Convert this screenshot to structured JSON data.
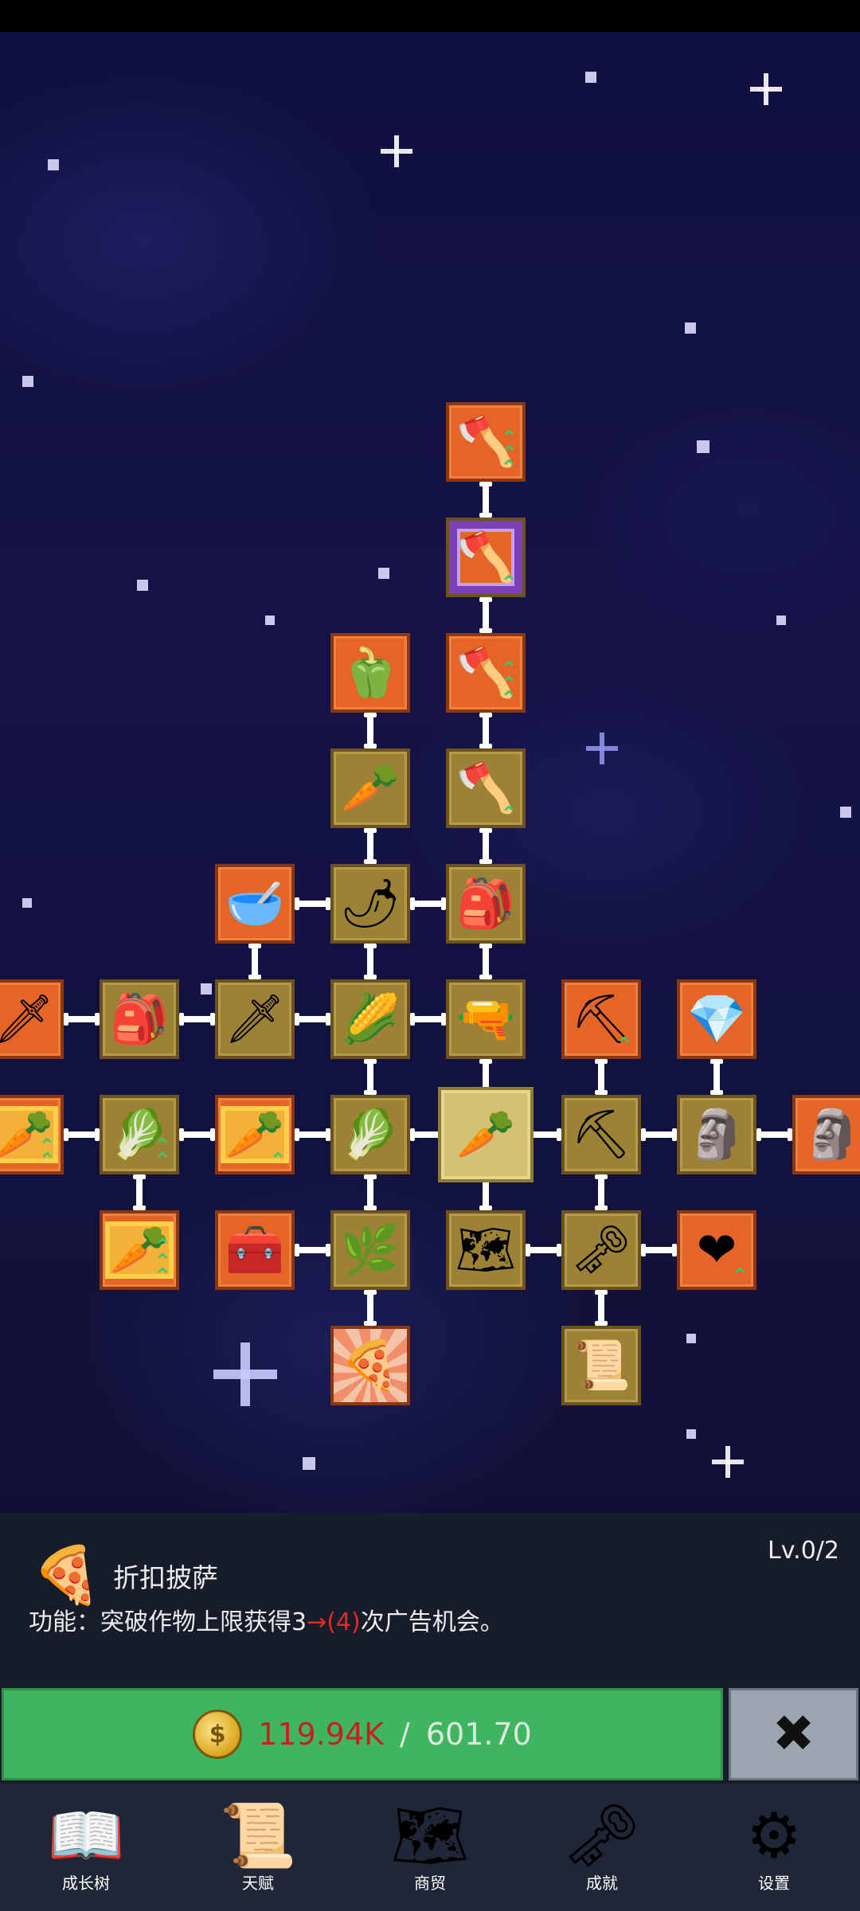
{
  "skill_tree": {
    "nodes": [
      {
        "id": "shovel-top",
        "icon": "🪓",
        "icon_name": "shovel-icon",
        "style": "orange",
        "badge": "⌃⌃⌃"
      },
      {
        "id": "shovel-magic",
        "icon": "🪓",
        "icon_name": "magic-shovel-icon",
        "style": "purple",
        "badge": "⌃"
      },
      {
        "id": "pepper",
        "icon": "🫑",
        "icon_name": "bell-pepper-icon",
        "style": "orange",
        "badge": ""
      },
      {
        "id": "shovel-3",
        "icon": "🪓",
        "icon_name": "shovel-icon",
        "style": "orange",
        "badge": "⌃⌃⌃"
      },
      {
        "id": "radish",
        "icon": "🥕",
        "icon_name": "white-radish-icon",
        "style": "gold",
        "badge": ""
      },
      {
        "id": "shovel-4",
        "icon": "🪓",
        "icon_name": "shovel-icon",
        "style": "gold",
        "badge": "⌃"
      },
      {
        "id": "bowl",
        "icon": "🥣",
        "icon_name": "wooden-bowl-icon",
        "style": "orange",
        "badge": ""
      },
      {
        "id": "chili",
        "icon": "🌶",
        "icon_name": "chili-pepper-icon",
        "style": "gold",
        "badge": ""
      },
      {
        "id": "backpack-1",
        "icon": "🎒",
        "icon_name": "backpack-icon",
        "style": "gold",
        "badge": ""
      },
      {
        "id": "sword-edge",
        "icon": "🗡",
        "icon_name": "sword-icon",
        "style": "orange",
        "badge": ""
      },
      {
        "id": "backpack-2",
        "icon": "🎒",
        "icon_name": "backpack-icon",
        "style": "gold",
        "badge": ""
      },
      {
        "id": "sword-2",
        "icon": "🗡",
        "icon_name": "sword-icon",
        "style": "gold",
        "badge": ""
      },
      {
        "id": "corn",
        "icon": "🌽",
        "icon_name": "corn-icon",
        "style": "gold",
        "badge": ""
      },
      {
        "id": "rifle",
        "icon": "🔫",
        "icon_name": "rifle-icon",
        "style": "gold",
        "badge": ""
      },
      {
        "id": "pickaxe-orange",
        "icon": "⛏",
        "icon_name": "pickaxe-icon",
        "style": "orange",
        "badge": "⌃"
      },
      {
        "id": "crystal",
        "icon": "💎",
        "icon_name": "crystal-icon",
        "style": "orange",
        "badge": ""
      },
      {
        "id": "carrot-edge",
        "icon": "🥕",
        "icon_name": "carrot-icon",
        "style": "orange-yellow",
        "badge": "⌃⌃"
      },
      {
        "id": "cabbage-1",
        "icon": "🥬",
        "icon_name": "cabbage-icon",
        "style": "gold",
        "badge": "⌃⌃"
      },
      {
        "id": "carrot-2",
        "icon": "🥕",
        "icon_name": "carrot-icon",
        "style": "orange-yellow",
        "badge": "⌃"
      },
      {
        "id": "cabbage-2",
        "icon": "🥬",
        "icon_name": "cabbage-icon",
        "style": "gold",
        "badge": ""
      },
      {
        "id": "carrot-root",
        "icon": "🥕",
        "icon_name": "carrot-icon",
        "style": "selected",
        "badge": ""
      },
      {
        "id": "pickaxe-gold",
        "icon": "⛏",
        "icon_name": "pickaxe-icon",
        "style": "gold",
        "badge": ""
      },
      {
        "id": "statue-1",
        "icon": "🗿",
        "icon_name": "statue-icon",
        "style": "gold",
        "badge": ""
      },
      {
        "id": "statue-edge",
        "icon": "🗿",
        "icon_name": "statue-icon",
        "style": "orange",
        "badge": ""
      },
      {
        "id": "carrot-3",
        "icon": "🥕",
        "icon_name": "carrot-icon",
        "style": "orange-yellow",
        "badge": "⌃⌃⌃"
      },
      {
        "id": "chest",
        "icon": "🧰",
        "icon_name": "treasure-chest-icon",
        "style": "orange",
        "badge": ""
      },
      {
        "id": "leek",
        "icon": "🌿",
        "icon_name": "leek-icon",
        "style": "gold",
        "badge": ""
      },
      {
        "id": "map",
        "icon": "🗺",
        "icon_name": "map-icon",
        "style": "gold",
        "badge": ""
      },
      {
        "id": "key",
        "icon": "🗝",
        "icon_name": "golden-key-icon",
        "style": "gold",
        "badge": ""
      },
      {
        "id": "heart",
        "icon": "❤",
        "icon_name": "heart-icon",
        "style": "orange",
        "badge": "⌃"
      },
      {
        "id": "pizza",
        "icon": "🍕",
        "icon_name": "pizza-icon",
        "style": "burst",
        "badge": ""
      },
      {
        "id": "scroll",
        "icon": "📜",
        "icon_name": "scroll-icon",
        "style": "gold",
        "badge": ""
      }
    ]
  },
  "info_panel": {
    "item_icon": "pizza-icon",
    "item_name": "折扣披萨",
    "level": "Lv.0/2",
    "desc_prefix": "功能：突破作物上限获得3",
    "desc_highlight": "→(4)",
    "desc_suffix": "次广告机会。"
  },
  "purchase": {
    "currency_icon": "coin-icon",
    "owned": "119.94K",
    "separator": "/",
    "cost": "601.70",
    "close_icon": "close-icon"
  },
  "bottom_nav": [
    {
      "label": "成长树",
      "icon": "📖",
      "icon_name": "book-icon"
    },
    {
      "label": "天赋",
      "icon": "📜",
      "icon_name": "scroll-icon"
    },
    {
      "label": "商贸",
      "icon": "🗺",
      "icon_name": "map-icon"
    },
    {
      "label": "成就",
      "icon": "🗝",
      "icon_name": "key-icon"
    },
    {
      "label": "设置",
      "icon": "⚙",
      "icon_name": "gear-icon"
    }
  ],
  "colors": {
    "sky": "#12123f",
    "node_gold": "#9b8234",
    "node_orange": "#e46526",
    "buy_button": "#3eb55e",
    "price_highlight": "#c62020",
    "panel_bg": "#171c2b",
    "nav_bg": "#1f2637"
  }
}
